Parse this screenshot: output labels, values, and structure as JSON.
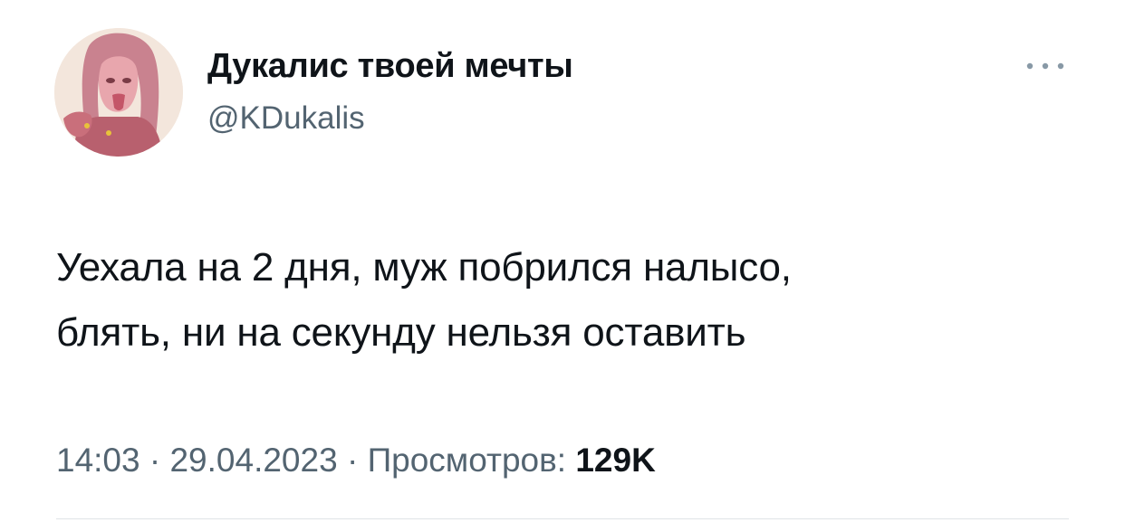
{
  "author": {
    "display_name": "Дукалис твоей мечты",
    "handle": "@KDukalis",
    "avatar_icon": "profile-avatar-illustration"
  },
  "tweet": {
    "text_lines": [
      "Уехала на 2 дня, муж побрился налысо,",
      "блять, ни на секунду нельзя оставить"
    ]
  },
  "meta": {
    "time": "14:03",
    "separator": "·",
    "date": "29.04.2023",
    "views_label": "Просмотров:",
    "views_count": "129K"
  },
  "actions": {
    "more_icon": "more-horizontal-icon"
  },
  "colors": {
    "text_primary": "#0f1419",
    "text_secondary": "#536471",
    "divider": "#dfe3e6",
    "background": "#ffffff"
  }
}
